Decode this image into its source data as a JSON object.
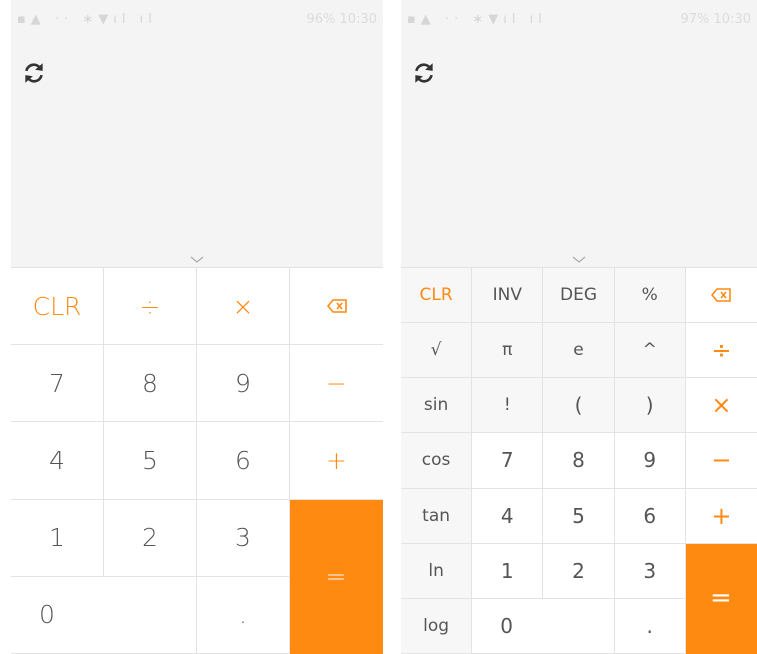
{
  "left": {
    "status_right": "96%  10:30",
    "icons": {
      "history": "history-refresh-icon",
      "expand": "chevron-down-icon",
      "backspace": "backspace-icon"
    },
    "keys": {
      "clr": "CLR",
      "divide": "÷",
      "multiply": "×",
      "seven": "7",
      "eight": "8",
      "nine": "9",
      "minus": "−",
      "four": "4",
      "five": "5",
      "six": "6",
      "plus": "+",
      "one": "1",
      "two": "2",
      "three": "3",
      "equals": "=",
      "zero": "0",
      "dot": "."
    }
  },
  "right": {
    "status_right": "97%  10:30",
    "icons": {
      "history": "history-refresh-icon",
      "expand": "chevron-down-icon",
      "backspace": "backspace-icon"
    },
    "keys": {
      "clr": "CLR",
      "inv": "INV",
      "deg": "DEG",
      "percent": "%",
      "sqrt": "√",
      "pi": "π",
      "e": "e",
      "power": "^",
      "divide": "÷",
      "sin": "sin",
      "factorial": "!",
      "lparen": "(",
      "rparen": ")",
      "multiply": "×",
      "cos": "cos",
      "seven": "7",
      "eight": "8",
      "nine": "9",
      "minus": "−",
      "tan": "tan",
      "four": "4",
      "five": "5",
      "six": "6",
      "plus": "+",
      "ln": "ln",
      "one": "1",
      "two": "2",
      "three": "3",
      "equals": "=",
      "log": "log",
      "zero": "0",
      "dot": "."
    }
  },
  "colors": {
    "accent": "#ff8a12",
    "display_bg": "#f4f4f4",
    "text": "#555555"
  }
}
